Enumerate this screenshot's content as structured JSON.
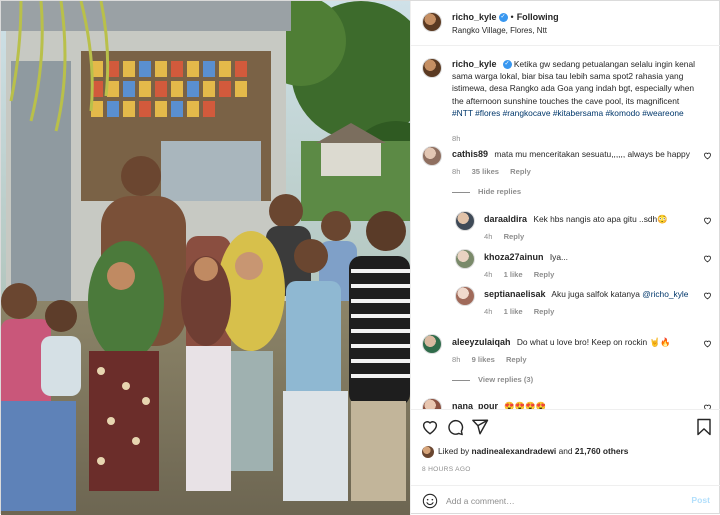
{
  "header": {
    "username": "richo_kyle",
    "follow_separator": "•",
    "follow_label": "Following",
    "location": "Rangko Village, Flores, Ntt"
  },
  "caption": {
    "username": "richo_kyle",
    "text": "Ketika gw sedang petualangan selalu ingin kenal sama warga lokal, biar bisa tau lebih sama spot2 rahasia yang istimewa, desa Rangko ada Goa yang indah bgt, especially when the afternoon sunshine touches the cave pool, its magnificent",
    "hashtags": "#NTT #flores #rangkocave #kitabersama #komodo #weareone",
    "time": "8h"
  },
  "comments": [
    {
      "username": "cathis89",
      "text": "mata mu menceritakan sesuatu,,,,,, always be happy",
      "time": "8h",
      "likes": "35 likes",
      "reply": "Reply",
      "toggle": "Hide replies",
      "replies": [
        {
          "username": "daraaldira",
          "text": "Kek hbs nangis ato apa gitu ..sdh😳",
          "time": "4h",
          "likes": "",
          "reply": "Reply"
        },
        {
          "username": "khoza27ainun",
          "text": "Iya...",
          "time": "4h",
          "likes": "1 like",
          "reply": "Reply"
        },
        {
          "username": "septianaelisak",
          "text": "Aku juga salfok katanya",
          "mention": "@richo_kyle",
          "time": "4h",
          "likes": "1 like",
          "reply": "Reply"
        }
      ]
    },
    {
      "username": "aleeyzulaiqah",
      "text": "Do what u love bro! Keep on rockin 🤘🔥",
      "time": "8h",
      "likes": "9 likes",
      "reply": "Reply",
      "toggle": "View replies (3)"
    },
    {
      "username": "nana_pour",
      "text": "😍😍😍😍"
    }
  ],
  "actions": {
    "liked_by_prefix": "Liked by",
    "liked_by_user": "nadinealexandradewi",
    "liked_by_and": "and",
    "liked_by_others": "21,760 others",
    "time_ago": "8 HOURS AGO"
  },
  "add_comment": {
    "placeholder": "Add a comment…",
    "post_label": "Post"
  },
  "colors": {
    "link": "#00376b",
    "verified": "#3897f0",
    "muted": "#8e8e8e",
    "post_disabled": "#b2dffc"
  },
  "icons": [
    "heart-icon",
    "comment-icon",
    "share-icon",
    "bookmark-icon",
    "emoji-icon",
    "verified-badge-icon"
  ]
}
